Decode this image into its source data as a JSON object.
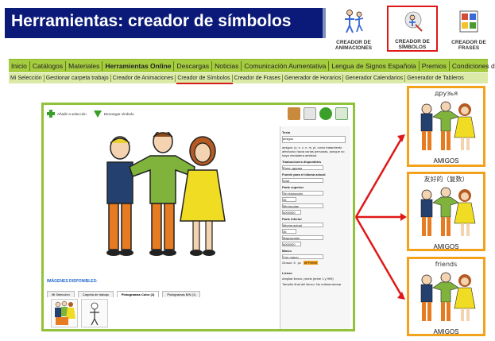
{
  "header": {
    "title": "Herramientas: creador de símbolos"
  },
  "tools": [
    {
      "label_l1": "CREADOR DE",
      "label_l2": "ANIMACIONES"
    },
    {
      "label_l1": "CREADOR DE",
      "label_l2": "SÍMBOLOS"
    },
    {
      "label_l1": "CREADOR DE",
      "label_l2": "FRASES"
    }
  ],
  "menu_main": [
    "Inicio",
    "Catálogos",
    "Materiales",
    "Herramientas Online",
    "Descargas",
    "Noticias",
    "Comunicación Aumentativa",
    "Lengua de Signos Española",
    "Premios",
    "Condiciones de Uso"
  ],
  "menu_sub": [
    "Mi Selección",
    "Gestionar carpeta trabajo",
    "Creador de Animaciones",
    "Creador de Símbolos",
    "Creador de Frases",
    "Generador de Horarios",
    "Generador Calendarios",
    "Generador de Tableros"
  ],
  "editor": {
    "add_label": "Añadir a selección",
    "download_label": "Descargar símbolo",
    "images_title": "IMÁGENES DISPONIBLES:",
    "tabs": [
      "Mi Selección",
      "Carpeta de trabajo",
      "Pictogramas Color (2)",
      "Pictogramas B/N (1)"
    ],
    "panel": {
      "texto_h": "Texto",
      "texto_val": "amigos",
      "desc": "amigos: (c. s. c. n. m. pl. como tratamiento afectuoso hacia varias personas, aunque no haya verdadera amistad.",
      "trad_h": "Traducciones disponibles",
      "trad_val": "Ruso: друзья",
      "fuente_h": "Fuente para el idioma actual:",
      "fuente_val": "Arial",
      "sup_h": "Parte superior",
      "sup_val": "Sin traducción",
      "sup_size": "36",
      "sup_case": "Minúsculas",
      "sup_color": "#000000",
      "inf_h": "Parte inferior",
      "inf_val": "Idioma actual",
      "inf_size": "36",
      "inf_case": "Mayúsculas",
      "inf_color": "#000000",
      "marco_h": "Marco",
      "marco_val": "Con marco",
      "grosor": "Grosor: 5",
      "px": "px",
      "marco_color": "#FF9900",
      "lienzo_h": "Lienzo",
      "ampliar": "Ampliar lienzo:",
      "ampliar_hint": "pixels (entre 1 y 999)",
      "tamano": "Tamaño final del lienzo:",
      "tamano_val": "No redimensionar"
    }
  },
  "cards": [
    {
      "top": "друзья",
      "bottom": "AMIGOS"
    },
    {
      "top": "友好的（复数）",
      "bottom": "AMIGOS"
    },
    {
      "top": "friends",
      "bottom": "AMIGOS"
    }
  ],
  "colors": {
    "title_bg": "#0b1a78",
    "menu_green": "#a6cc40",
    "submenu_green": "#dceaa8",
    "frame_green": "#92c13a",
    "card_orange": "#f4a21c",
    "arrow_red": "#e01818"
  }
}
